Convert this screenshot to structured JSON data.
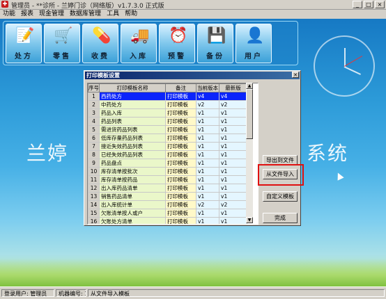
{
  "window": {
    "title": "管理员 - **诊所 - 兰婷门诊（网络版）v1.7.3.0 正式版",
    "buttons": [
      "_",
      "□",
      "×"
    ]
  },
  "menu": [
    "功能",
    "报表",
    "现金管理",
    "数据库管理",
    "工具",
    "帮助"
  ],
  "toolbar": [
    {
      "label": "处方",
      "icon": "prescription-icon",
      "glyph": "📝"
    },
    {
      "label": "零售",
      "icon": "retail-cart-icon",
      "glyph": "🛒"
    },
    {
      "label": "收费",
      "icon": "charge-icon",
      "glyph": "💊"
    },
    {
      "label": "入库",
      "icon": "truck-icon",
      "glyph": "🚚"
    },
    {
      "label": "预警",
      "icon": "alarm-clock-icon",
      "glyph": "⏰"
    },
    {
      "label": "备份",
      "icon": "floppy-disk-icon",
      "glyph": "💾"
    },
    {
      "label": "用户",
      "icon": "user-icon",
      "glyph": "👤"
    }
  ],
  "background": {
    "left_text": "兰婷",
    "right_text": "系统"
  },
  "dialog": {
    "title": "打印模板设置",
    "columns": [
      "序号",
      "打印模板名称",
      "备注",
      "当前版本",
      "最新版"
    ],
    "rows": [
      {
        "no": "1",
        "name": "西药处方",
        "note": "打印模板",
        "cur": "v4",
        "latest": "v4",
        "selected": true
      },
      {
        "no": "2",
        "name": "中药处方",
        "note": "打印模板",
        "cur": "v2",
        "latest": "v2"
      },
      {
        "no": "3",
        "name": "药品入库",
        "note": "打印模板",
        "cur": "v1",
        "latest": "v1"
      },
      {
        "no": "4",
        "name": "药品列表",
        "note": "打印模板",
        "cur": "v1",
        "latest": "v1"
      },
      {
        "no": "5",
        "name": "需进货药品列表",
        "note": "打印模板",
        "cur": "v1",
        "latest": "v1"
      },
      {
        "no": "6",
        "name": "低库存量药品列表",
        "note": "打印模板",
        "cur": "v1",
        "latest": "v1"
      },
      {
        "no": "7",
        "name": "接近失效药品列表",
        "note": "打印模板",
        "cur": "v1",
        "latest": "v1"
      },
      {
        "no": "8",
        "name": "已经失效药品列表",
        "note": "打印模板",
        "cur": "v1",
        "latest": "v1"
      },
      {
        "no": "9",
        "name": "药品盘点",
        "note": "打印模板",
        "cur": "v1",
        "latest": "v1"
      },
      {
        "no": "10",
        "name": "库存清单按批次",
        "note": "打印模板",
        "cur": "v1",
        "latest": "v1"
      },
      {
        "no": "11",
        "name": "库存清单按药品",
        "note": "打印模板",
        "cur": "v1",
        "latest": "v1"
      },
      {
        "no": "12",
        "name": "出入库药品清单",
        "note": "打印模板",
        "cur": "v1",
        "latest": "v1"
      },
      {
        "no": "13",
        "name": "销售药品清单",
        "note": "打印模板",
        "cur": "v1",
        "latest": "v1"
      },
      {
        "no": "14",
        "name": "出入库统计单",
        "note": "打印模板",
        "cur": "v2",
        "latest": "v2"
      },
      {
        "no": "15",
        "name": "欠账清单按人或户",
        "note": "打印模板",
        "cur": "v1",
        "latest": "v1"
      },
      {
        "no": "16",
        "name": "欠账处方清单",
        "note": "打印模板",
        "cur": "v1",
        "latest": "v1"
      },
      {
        "no": "17",
        "name": "处方清单",
        "note": "打印模板",
        "cur": "v1",
        "latest": "v1"
      }
    ],
    "buttons": {
      "export": "导出到文件",
      "import": "从文件导入",
      "custom": "自定义模板",
      "done": "完成"
    }
  },
  "status": {
    "user": "登录用户: 管理员",
    "machine": "机器编号: 1",
    "action": "从文件导入模板"
  },
  "colors": {
    "selected_row": "#0b24fb",
    "highlight_box": "#e01010",
    "dialog_title": "#0a246a"
  }
}
